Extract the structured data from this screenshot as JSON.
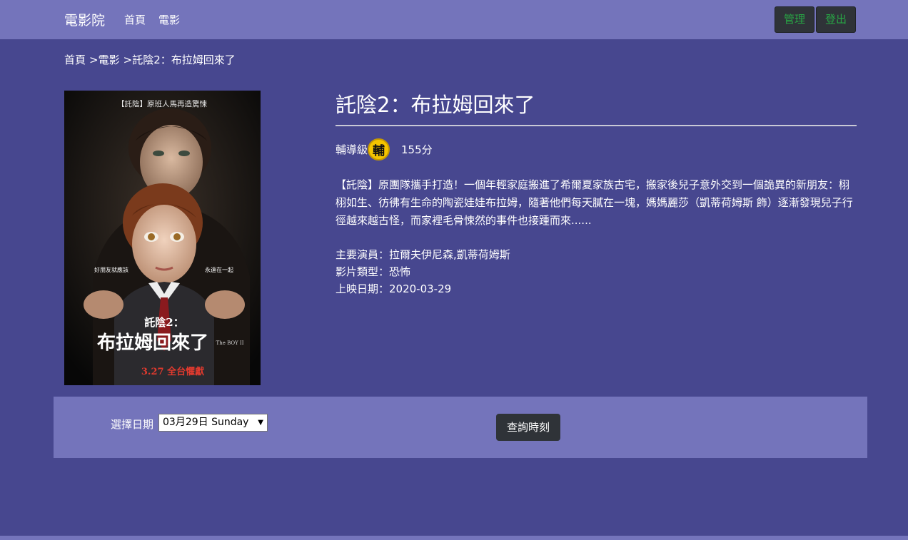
{
  "navbar": {
    "brand": "電影院",
    "links": [
      "首頁",
      "電影"
    ],
    "admin_label": "管理",
    "logout_label": "登出"
  },
  "breadcrumb": {
    "items": [
      "首頁",
      "電影",
      "託陰2：布拉姆回來了"
    ],
    "separator": ">"
  },
  "movie": {
    "title": "託陰2：布拉姆回來了",
    "rating_label": "輔導級",
    "rating_badge": "輔",
    "duration": "155分",
    "description": "【託陰】原團隊攜手打造！一個年輕家庭搬進了希爾夏家族古宅，搬家後兒子意外交到一個詭異的新朋友：栩栩如生、彷彿有生命的陶瓷娃娃布拉姆，隨著他們每天膩在一塊，媽媽麗莎（凱蒂荷姆斯 飾）逐漸發現兒子行徑越來越古怪，而家裡毛骨悚然的事件也接踵而來......",
    "cast": "主要演員：拉爾夫伊尼森,凱蒂荷姆斯",
    "genre": "影片類型：恐怖",
    "release": "上映日期：2020-03-29",
    "poster": {
      "top_text": "【託陰】原班人馬再造驚悚",
      "left_tagline": "好朋友就應該",
      "right_tagline": "永遠在一起",
      "title_small": "託陰2：",
      "title_big": "布拉姆回來了",
      "en_title": "The BOY II",
      "date_text": "3.27 全台懼獻"
    }
  },
  "query": {
    "date_label": "選擇日期",
    "selected_date": "03月29日 Sunday",
    "button_label": "查詢時刻"
  },
  "colors": {
    "page_bg": "#47478f",
    "navbar_bg": "#7474bb",
    "button_dark": "#2f3338",
    "button_green_text": "#28a745",
    "badge_yellow": "#f5c400"
  }
}
